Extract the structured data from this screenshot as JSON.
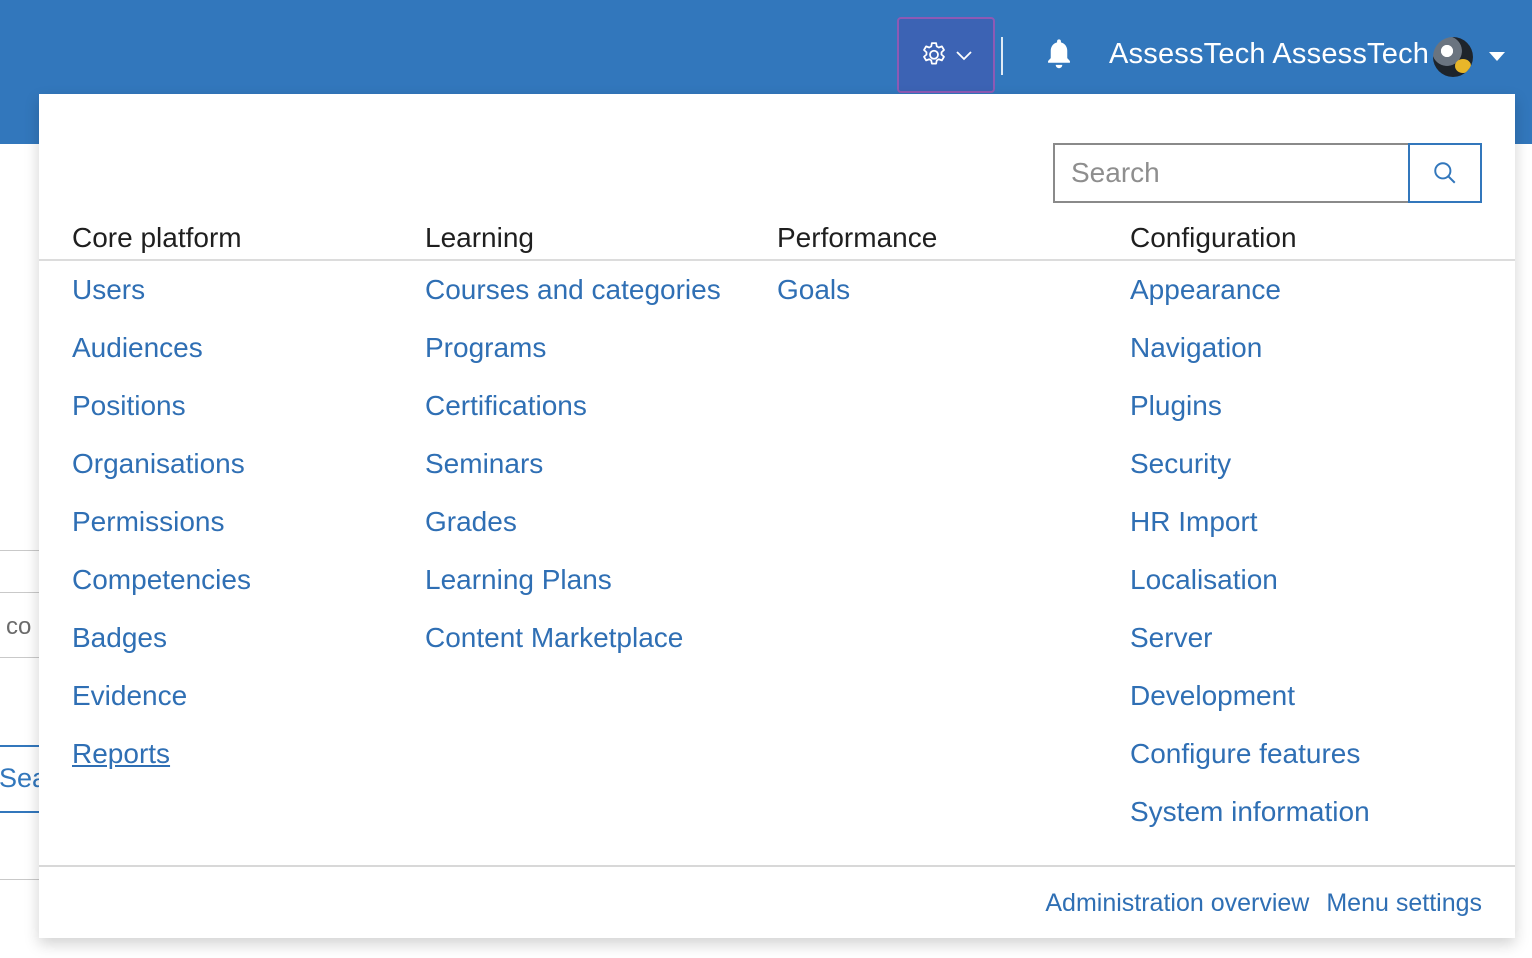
{
  "header": {
    "username": "AssessTech AssessTech",
    "colors": {
      "bar": "#3277bc",
      "admin_highlight": "#8d5ab5"
    }
  },
  "admin_menu": {
    "search": {
      "placeholder": "Search"
    },
    "columns": [
      {
        "title": "Core platform",
        "items": [
          "Users",
          "Audiences",
          "Positions",
          "Organisations",
          "Permissions",
          "Competencies",
          "Badges",
          "Evidence",
          "Reports"
        ]
      },
      {
        "title": "Learning",
        "items": [
          "Courses and categories",
          "Programs",
          "Certifications",
          "Seminars",
          "Grades",
          "Learning Plans",
          "Content Marketplace"
        ]
      },
      {
        "title": "Performance",
        "items": [
          "Goals"
        ]
      },
      {
        "title": "Configuration",
        "items": [
          "Appearance",
          "Navigation",
          "Plugins",
          "Security",
          "HR Import",
          "Localisation",
          "Server",
          "Development",
          "Configure features",
          "System information"
        ]
      }
    ],
    "footer": {
      "overview_label": "Administration overview",
      "settings_label": "Menu settings"
    },
    "link_color": "#2f6fb4"
  },
  "background": {
    "partial_text": "co",
    "partial_search": "Sea"
  }
}
